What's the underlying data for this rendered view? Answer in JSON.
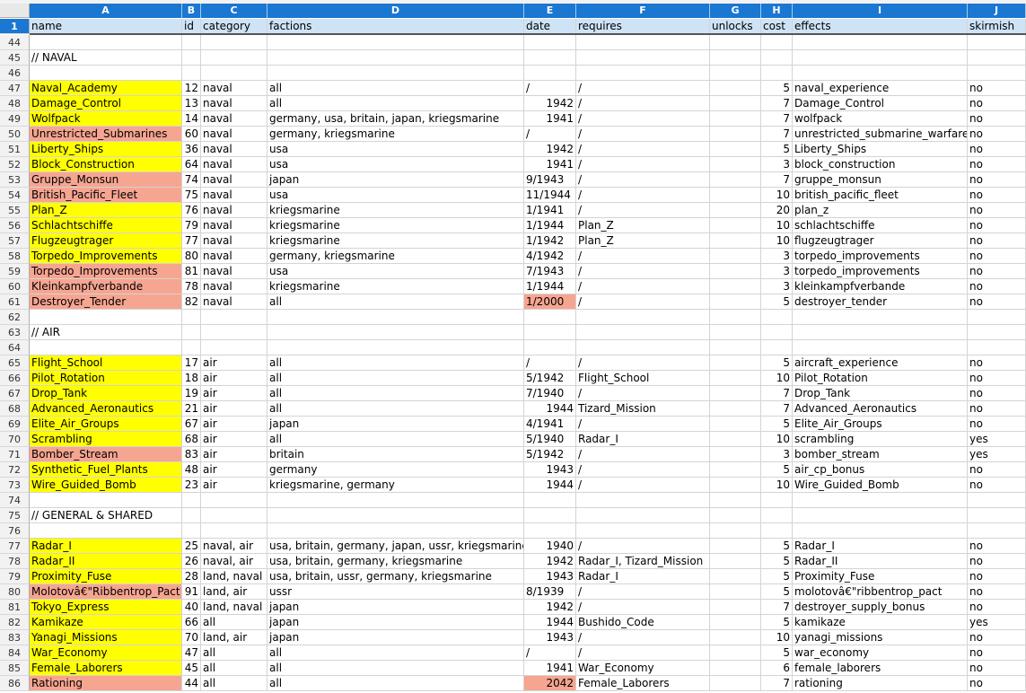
{
  "columns": [
    {
      "letter": "A",
      "name": "name"
    },
    {
      "letter": "B",
      "name": "id"
    },
    {
      "letter": "C",
      "name": "category"
    },
    {
      "letter": "D",
      "name": "factions"
    },
    {
      "letter": "E",
      "name": "date"
    },
    {
      "letter": "F",
      "name": "requires"
    },
    {
      "letter": "G",
      "name": "unlocks"
    },
    {
      "letter": "H",
      "name": "cost"
    },
    {
      "letter": "I",
      "name": "effects"
    },
    {
      "letter": "J",
      "name": "skirmish"
    }
  ],
  "colors": {
    "yellow": "#ffff00",
    "salmon": "#f6a591",
    "header_blue": "#1a77d2",
    "header_row": "#cfe3f7"
  },
  "header_row_number": "1",
  "rows": [
    {
      "n": "44",
      "cells": [
        "",
        "",
        "",
        "",
        "",
        "",
        "",
        "",
        "",
        ""
      ]
    },
    {
      "n": "45",
      "cells": [
        "// NAVAL",
        "",
        "",
        "",
        "",
        "",
        "",
        "",
        "",
        ""
      ]
    },
    {
      "n": "46",
      "cells": [
        "",
        "",
        "",
        "",
        "",
        "",
        "",
        "",
        "",
        ""
      ]
    },
    {
      "n": "47",
      "name_bg": "yellow",
      "cells": [
        "Naval_Academy",
        "12",
        "naval",
        "all",
        "/",
        "/",
        "",
        "5",
        "naval_experience",
        "no"
      ]
    },
    {
      "n": "48",
      "name_bg": "yellow",
      "cells": [
        "Damage_Control",
        "13",
        "naval",
        "all",
        "1942",
        "/",
        "",
        "7",
        "Damage_Control",
        "no"
      ]
    },
    {
      "n": "49",
      "name_bg": "yellow",
      "cells": [
        "Wolfpack",
        "14",
        "naval",
        "germany, usa, britain, japan, kriegsmarine",
        "1941",
        "/",
        "",
        "7",
        "wolfpack",
        "no"
      ]
    },
    {
      "n": "50",
      "name_bg": "salmon",
      "cells": [
        "Unrestricted_Submarines",
        "60",
        "naval",
        "germany, kriegsmarine",
        "/",
        "/",
        "",
        "7",
        "unrestricted_submarine_warfare",
        "no"
      ]
    },
    {
      "n": "51",
      "name_bg": "yellow",
      "cells": [
        "Liberty_Ships",
        "36",
        "naval",
        "usa",
        "1942",
        "/",
        "",
        "5",
        "Liberty_Ships",
        "no"
      ]
    },
    {
      "n": "52",
      "name_bg": "yellow",
      "cells": [
        "Block_Construction",
        "64",
        "naval",
        "usa",
        "1941",
        "/",
        "",
        "3",
        "block_construction",
        "no"
      ]
    },
    {
      "n": "53",
      "name_bg": "salmon",
      "cells": [
        "Gruppe_Monsun",
        "74",
        "naval",
        "japan",
        "9/1943",
        "/",
        "",
        "7",
        "gruppe_monsun",
        "no"
      ]
    },
    {
      "n": "54",
      "name_bg": "salmon",
      "cells": [
        "British_Pacific_Fleet",
        "75",
        "naval",
        "usa",
        "11/1944",
        "/",
        "",
        "10",
        "british_pacific_fleet",
        "no"
      ]
    },
    {
      "n": "55",
      "name_bg": "yellow",
      "cells": [
        "Plan_Z",
        "76",
        "naval",
        "kriegsmarine",
        "1/1941",
        "/",
        "",
        "20",
        "plan_z",
        "no"
      ]
    },
    {
      "n": "56",
      "name_bg": "yellow",
      "cells": [
        "Schlachtschiffe",
        "79",
        "naval",
        "kriegsmarine",
        "1/1944",
        "Plan_Z",
        "",
        "10",
        "schlachtschiffe",
        "no"
      ]
    },
    {
      "n": "57",
      "name_bg": "yellow",
      "cells": [
        "Flugzeugtrager",
        "77",
        "naval",
        "kriegsmarine",
        "1/1942",
        "Plan_Z",
        "",
        "10",
        "flugzeugtrager",
        "no"
      ]
    },
    {
      "n": "58",
      "name_bg": "yellow",
      "cells": [
        "Torpedo_Improvements",
        "80",
        "naval",
        "germany, kriegsmarine",
        "4/1942",
        "/",
        "",
        "3",
        "torpedo_improvements",
        "no"
      ]
    },
    {
      "n": "59",
      "name_bg": "salmon",
      "cells": [
        "Torpedo_Improvements",
        "81",
        "naval",
        "usa",
        "7/1943",
        "/",
        "",
        "3",
        "torpedo_improvements",
        "no"
      ]
    },
    {
      "n": "60",
      "name_bg": "salmon",
      "cells": [
        "Kleinkampfverbande",
        "78",
        "naval",
        "kriegsmarine",
        "1/1944",
        "/",
        "",
        "3",
        "kleinkampfverbande",
        "no"
      ]
    },
    {
      "n": "61",
      "name_bg": "salmon",
      "date_bg": "salmon",
      "cells": [
        "Destroyer_Tender",
        "82",
        "naval",
        "all",
        "1/2000",
        "/",
        "",
        "5",
        "destroyer_tender",
        "no"
      ]
    },
    {
      "n": "62",
      "cells": [
        "",
        "",
        "",
        "",
        "",
        "",
        "",
        "",
        "",
        ""
      ]
    },
    {
      "n": "63",
      "cells": [
        "// AIR",
        "",
        "",
        "",
        "",
        "",
        "",
        "",
        "",
        ""
      ]
    },
    {
      "n": "64",
      "cells": [
        "",
        "",
        "",
        "",
        "",
        "",
        "",
        "",
        "",
        ""
      ]
    },
    {
      "n": "65",
      "name_bg": "yellow",
      "cells": [
        "Flight_School",
        "17",
        "air",
        "all",
        "/",
        "/",
        "",
        "5",
        "aircraft_experience",
        "no"
      ]
    },
    {
      "n": "66",
      "name_bg": "yellow",
      "cells": [
        "Pilot_Rotation",
        "18",
        "air",
        "all",
        "5/1942",
        "Flight_School",
        "",
        "10",
        "Pilot_Rotation",
        "no"
      ]
    },
    {
      "n": "67",
      "name_bg": "yellow",
      "cells": [
        "Drop_Tank",
        "19",
        "air",
        "all",
        "7/1940",
        "/",
        "",
        "7",
        "Drop_Tank",
        "no"
      ]
    },
    {
      "n": "68",
      "name_bg": "yellow",
      "cells": [
        "Advanced_Aeronautics",
        "21",
        "air",
        "all",
        "1944",
        "Tizard_Mission",
        "",
        "7",
        "Advanced_Aeronautics",
        "no"
      ]
    },
    {
      "n": "69",
      "name_bg": "yellow",
      "cells": [
        "Elite_Air_Groups",
        "67",
        "air",
        "japan",
        "4/1941",
        "/",
        "",
        "5",
        "Elite_Air_Groups",
        "no"
      ]
    },
    {
      "n": "70",
      "name_bg": "yellow",
      "cells": [
        "Scrambling",
        "68",
        "air",
        "all",
        "5/1940",
        "Radar_I",
        "",
        "10",
        "scrambling",
        "yes"
      ]
    },
    {
      "n": "71",
      "name_bg": "salmon",
      "cells": [
        "Bomber_Stream",
        "83",
        "air",
        "britain",
        "5/1942",
        "/",
        "",
        "3",
        "bomber_stream",
        "yes"
      ]
    },
    {
      "n": "72",
      "name_bg": "yellow",
      "cells": [
        "Synthetic_Fuel_Plants",
        "48",
        "air",
        "germany",
        "1943",
        "/",
        "",
        "5",
        "air_cp_bonus",
        "no"
      ]
    },
    {
      "n": "73",
      "name_bg": "yellow",
      "cells": [
        "Wire_Guided_Bomb",
        "23",
        "air",
        "kriegsmarine, germany",
        "1944",
        "/",
        "",
        "10",
        "Wire_Guided_Bomb",
        "no"
      ]
    },
    {
      "n": "74",
      "cells": [
        "",
        "",
        "",
        "",
        "",
        "",
        "",
        "",
        "",
        ""
      ]
    },
    {
      "n": "75",
      "cells": [
        "// GENERAL & SHARED",
        "",
        "",
        "",
        "",
        "",
        "",
        "",
        "",
        ""
      ]
    },
    {
      "n": "76",
      "cells": [
        "",
        "",
        "",
        "",
        "",
        "",
        "",
        "",
        "",
        ""
      ]
    },
    {
      "n": "77",
      "name_bg": "yellow",
      "cells": [
        "Radar_I",
        "25",
        "naval, air",
        "usa, britain, germany, japan, ussr, kriegsmarine",
        "1940",
        "/",
        "",
        "5",
        "Radar_I",
        "no"
      ]
    },
    {
      "n": "78",
      "name_bg": "yellow",
      "cells": [
        "Radar_II",
        "26",
        "naval, air",
        "usa, britain, germany, kriegsmarine",
        "1942",
        "Radar_I, Tizard_Mission",
        "",
        "5",
        "Radar_II",
        "no"
      ]
    },
    {
      "n": "79",
      "name_bg": "yellow",
      "cells": [
        "Proximity_Fuse",
        "28",
        "land, naval",
        "usa, britain, ussr, germany, kriegsmarine",
        "1943",
        "Radar_I",
        "",
        "5",
        "Proximity_Fuse",
        "no"
      ]
    },
    {
      "n": "80",
      "name_bg": "salmon",
      "cells": [
        "Molotovâ€\"Ribbentrop_Pact",
        "91",
        "land, air",
        "ussr",
        "8/1939",
        "/",
        "",
        "5",
        "molotovâ€\"ribbentrop_pact",
        "no"
      ]
    },
    {
      "n": "81",
      "name_bg": "yellow",
      "cells": [
        "Tokyo_Express",
        "40",
        "land, naval",
        "japan",
        "1942",
        "/",
        "",
        "7",
        "destroyer_supply_bonus",
        "no"
      ]
    },
    {
      "n": "82",
      "name_bg": "yellow",
      "cells": [
        "Kamikaze",
        "66",
        "all",
        "japan",
        "1944",
        "Bushido_Code",
        "",
        "5",
        "kamikaze",
        "yes"
      ]
    },
    {
      "n": "83",
      "name_bg": "yellow",
      "cells": [
        "Yanagi_Missions",
        "70",
        "land, air",
        "japan",
        "1943",
        "/",
        "",
        "10",
        "yanagi_missions",
        "no"
      ]
    },
    {
      "n": "84",
      "name_bg": "yellow",
      "cells": [
        "War_Economy",
        "47",
        "all",
        "all",
        "/",
        "/",
        "",
        "5",
        "war_economy",
        "no"
      ]
    },
    {
      "n": "85",
      "name_bg": "yellow",
      "cells": [
        "Female_Laborers",
        "45",
        "all",
        "all",
        "1941",
        "War_Economy",
        "",
        "6",
        "female_laborers",
        "no"
      ]
    },
    {
      "n": "86",
      "name_bg": "salmon",
      "date_bg": "salmon",
      "cells": [
        "Rationing",
        "44",
        "all",
        "all",
        "2042",
        "Female_Laborers",
        "",
        "7",
        "rationing",
        "no"
      ]
    }
  ]
}
